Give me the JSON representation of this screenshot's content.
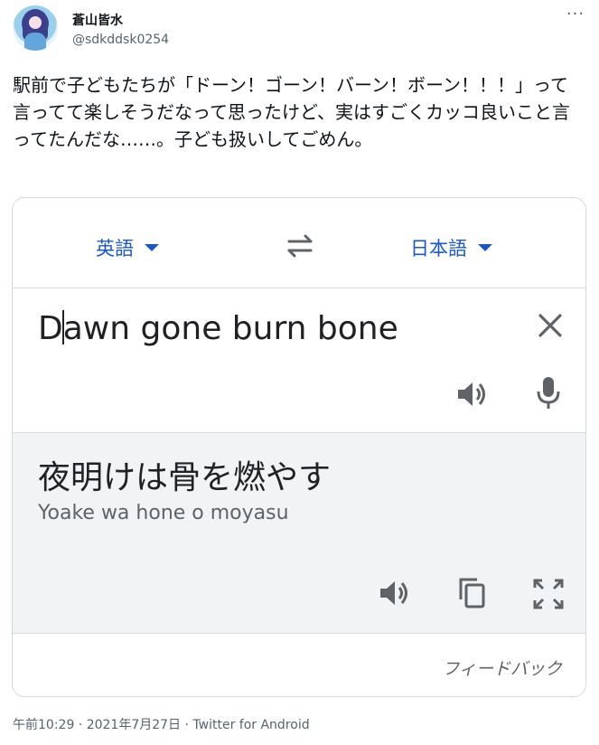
{
  "tweet": {
    "display_name": "蒼山皆水",
    "handle": "@sdkddsk0254",
    "more_label": "···",
    "text": "駅前で子どもたちが「ドーン！ゴーン！バーン！ボーン！！！」って言ってて楽しそうだなって思ったけど、実はすごくカッコ良いこと言ってたんだな……。子ども扱いしてごめん。",
    "timestamp": "午前10:29 · 2021年7月27日 · Twitter for Android"
  },
  "translate": {
    "source_lang": "英語",
    "target_lang": "日本語",
    "source_text_before_caret": "D",
    "source_text_after_caret": "awn gone burn bone",
    "translation": "夜明けは骨を燃やす",
    "romanization": "Yoake wa hone o moyasu",
    "feedback": "フィードバック",
    "accent_color": "#1a58c4"
  },
  "icons": {
    "swap": "swap-arrows-icon",
    "clear": "close-icon",
    "speaker": "speaker-icon",
    "mic": "microphone-icon",
    "copy": "copy-icon",
    "fullscreen": "fullscreen-icon",
    "more": "more-horizontal-icon"
  }
}
